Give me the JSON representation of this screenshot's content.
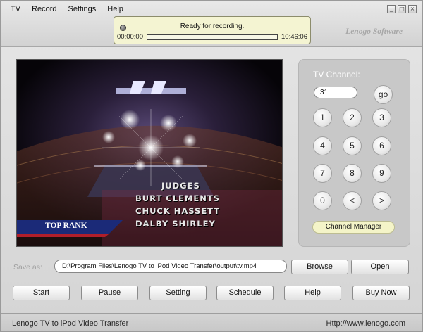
{
  "menu": [
    "TV",
    "Record",
    "Settings",
    "Help"
  ],
  "window_controls": [
    "_",
    "□",
    "×"
  ],
  "status": {
    "message": "Ready for recording.",
    "time_start": "00:00:00",
    "time_end": "10:46:06",
    "progress_fraction": 0.0
  },
  "brand": "Lenogo Software",
  "video": {
    "overlay_lines": [
      "JUDGES",
      "BURT CLEMENTS",
      "CHUCK HASSETT",
      "DALBY SHIRLEY"
    ],
    "logo_text": "TOP RANK"
  },
  "channel": {
    "label": "TV Channel:",
    "value": "31",
    "go_label": "go",
    "keys": [
      "1",
      "2",
      "3",
      "4",
      "5",
      "6",
      "7",
      "8",
      "9",
      "0",
      "<",
      ">"
    ],
    "manager_label": "Channel Manager"
  },
  "save": {
    "label": "Save as:",
    "path": "D:\\Program Files\\Lenogo TV to iPod Video Transfer\\output\\tv.mp4",
    "browse_label": "Browse",
    "open_label": "Open"
  },
  "actions": [
    "Start",
    "Pause",
    "Setting",
    "Schedule",
    "Help",
    "Buy Now"
  ],
  "footer": {
    "app_name": "Lenogo TV to iPod Video Transfer",
    "url": "Http://www.lenogo.com"
  },
  "colors": {
    "status_bg": "#f4f4d2",
    "manager_bg": "#f4f4c8",
    "channel_panel_bg": "#c8c8c8"
  }
}
